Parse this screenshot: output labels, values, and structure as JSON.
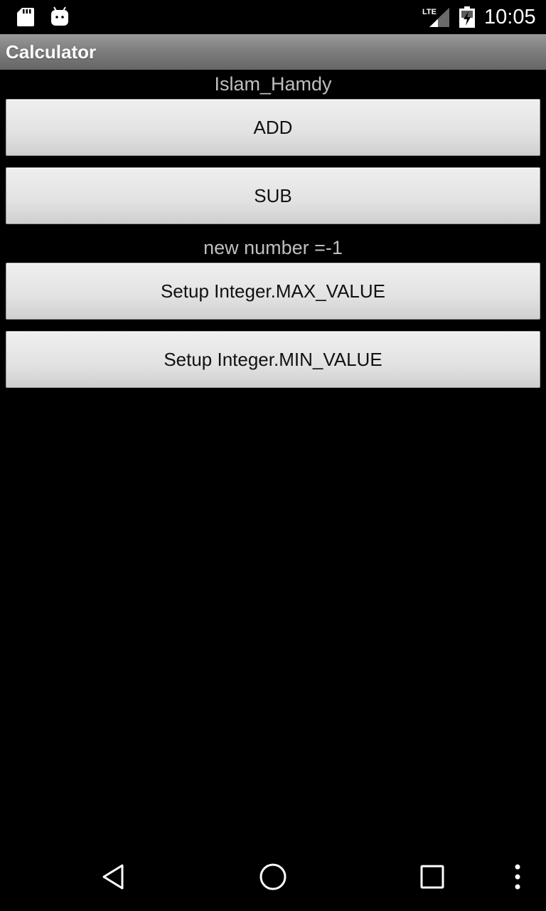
{
  "status_bar": {
    "time": "10:05",
    "network": "LTE",
    "icons": [
      "sd-card-icon",
      "android-icon",
      "lte-signal-icon",
      "battery-charging-icon"
    ]
  },
  "app": {
    "title": "Calculator"
  },
  "main": {
    "name_label": "Islam_Hamdy",
    "add_button": "ADD",
    "sub_button": "SUB",
    "result_label": "new number =-1",
    "max_button": "Setup Integer.MAX_VALUE",
    "min_button": "Setup Integer.MIN_VALUE"
  },
  "nav_bar": {
    "icons": [
      "back-icon",
      "home-icon",
      "recents-icon",
      "overflow-menu-icon"
    ]
  },
  "colors": {
    "background": "#000000",
    "title_bar": "#7c7c7c",
    "button_face": "#e2e2e2",
    "label_text": "#bfbfbf"
  }
}
